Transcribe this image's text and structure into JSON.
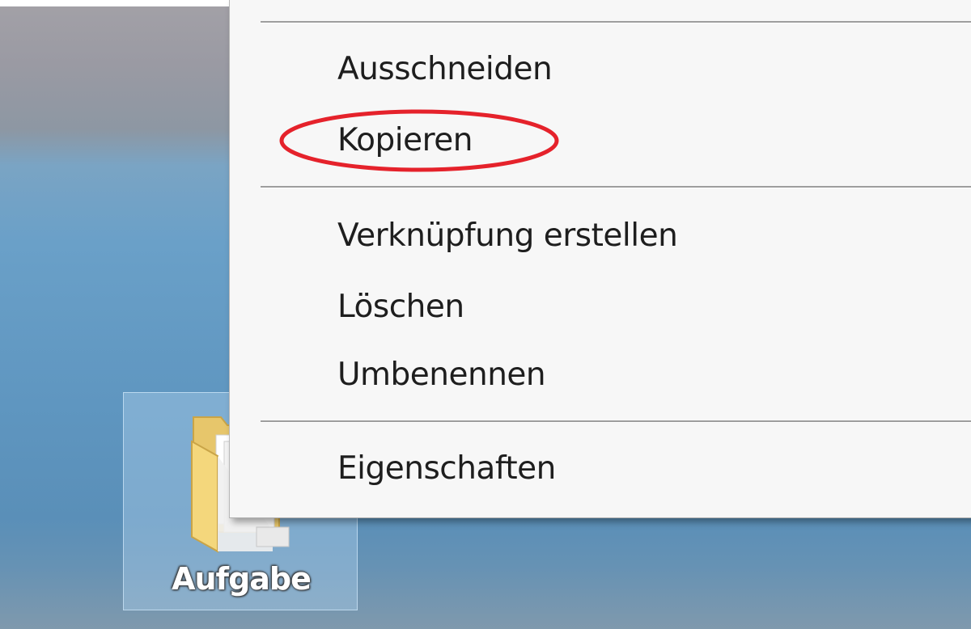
{
  "desktop": {
    "icon": {
      "label": "Aufgabe",
      "icon_name": "folder-icon",
      "selected": true
    }
  },
  "context_menu": {
    "groups": [
      {
        "items": [
          {
            "label": "Ausschneiden"
          },
          {
            "label": "Kopieren",
            "highlighted": true
          }
        ]
      },
      {
        "items": [
          {
            "label": "Verknüpfung erstellen"
          },
          {
            "label": "Löschen"
          },
          {
            "label": "Umbenennen"
          }
        ]
      },
      {
        "items": [
          {
            "label": "Eigenschaften"
          }
        ]
      }
    ]
  },
  "annotation": {
    "shape": "ellipse",
    "color": "#e5222b",
    "target": "Kopieren"
  },
  "colors": {
    "menu_background": "#f7f7f7",
    "separator": "#9e9e9e",
    "desktop": "#6aa0c8",
    "selection": "#a8cde8"
  }
}
